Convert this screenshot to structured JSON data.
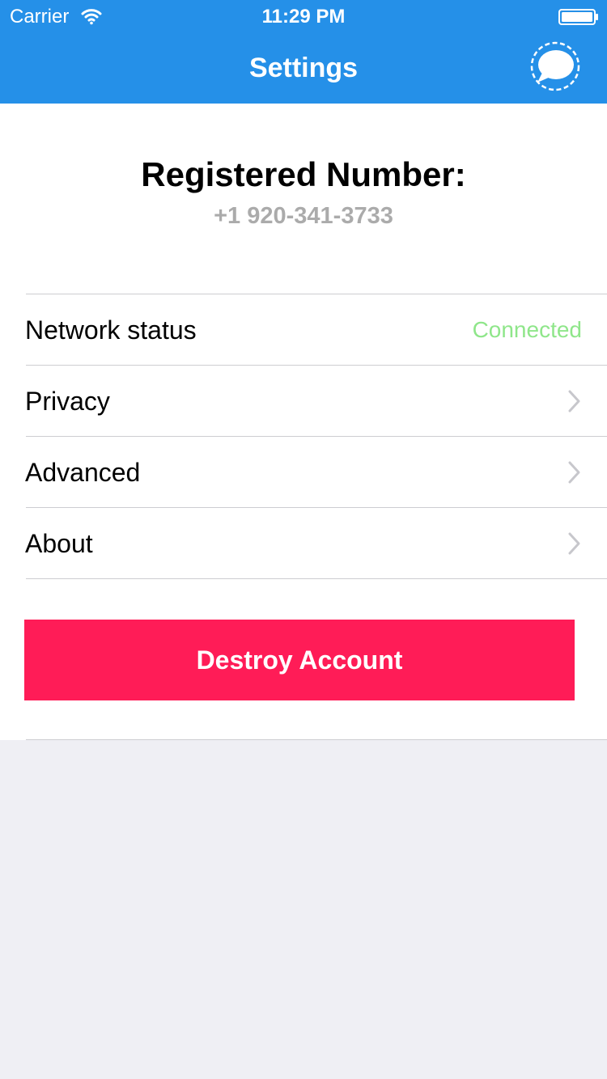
{
  "status_bar": {
    "carrier": "Carrier",
    "time": "11:29 PM",
    "icons": [
      "wifi-icon",
      "battery-icon"
    ]
  },
  "nav": {
    "title": "Settings",
    "action_icon": "compose-bubble-icon"
  },
  "header": {
    "label": "Registered Number:",
    "number": "+1 920-341-3733"
  },
  "menu": {
    "network": {
      "label": "Network status",
      "value": "Connected"
    },
    "privacy": {
      "label": "Privacy"
    },
    "advanced": {
      "label": "Advanced"
    },
    "about": {
      "label": "About"
    }
  },
  "destroy": {
    "label": "Destroy Account"
  },
  "colors": {
    "nav_bar": "#2590e8",
    "connected": "#8fe68a",
    "destroy_button": "#ff1c57",
    "background": "#efeff4"
  }
}
